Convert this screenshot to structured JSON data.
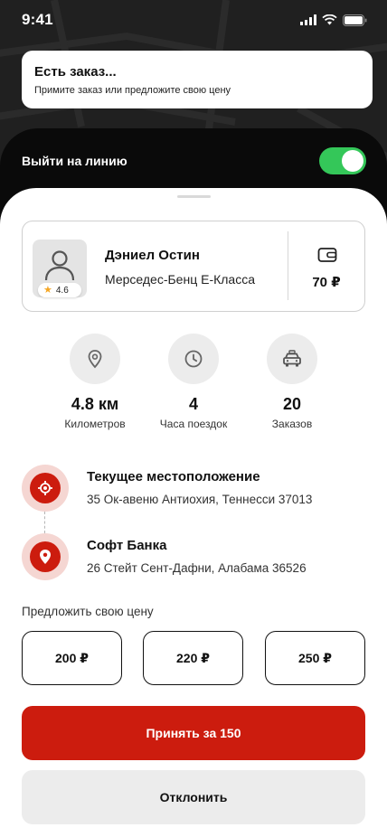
{
  "status_bar": {
    "time": "9:41",
    "signal_icon": "signal-bars-icon",
    "wifi_icon": "wifi-icon",
    "battery_icon": "battery-icon"
  },
  "order_banner": {
    "title": "Есть заказ...",
    "subtitle": "Примите заказ или предложите свою цену"
  },
  "online": {
    "label": "Выйти на линию",
    "enabled": true,
    "toggle_color": "#34c759"
  },
  "driver": {
    "name": "Дэниел Остин",
    "car": "Мерседес-Бенц Е-Класса",
    "rating": "4.6",
    "balance": "70 ₽",
    "avatar_icon": "user-icon",
    "wallet_icon": "wallet-icon"
  },
  "stats": [
    {
      "icon": "location-pin-icon",
      "value": "4.8 км",
      "label": "Километров"
    },
    {
      "icon": "clock-icon",
      "value": "4",
      "label": "Часа поездок"
    },
    {
      "icon": "taxi-icon",
      "value": "20",
      "label": "Заказов"
    }
  ],
  "route": {
    "from": {
      "title": "Текущее местоположение",
      "address": "35 Ок-авеню Антиохия, Теннесси 37013",
      "icon": "crosshair-icon"
    },
    "to": {
      "title": "Софт Банка",
      "address": "26 Стейт Сент-Дафни, Алабама 36526",
      "icon": "map-pin-icon"
    }
  },
  "offer": {
    "label": "Предложить свою цену",
    "prices": [
      "200 ₽",
      "220 ₽",
      "250 ₽"
    ]
  },
  "actions": {
    "accept": "Принять за 150",
    "decline": "Отклонить"
  },
  "colors": {
    "accent": "#cc1c0e",
    "accent_soft": "#f5d6d2",
    "toggle": "#34c759",
    "star": "#f5a623"
  }
}
